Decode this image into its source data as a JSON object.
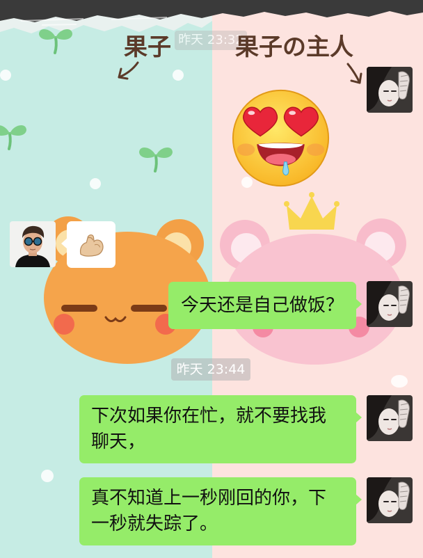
{
  "colors": {
    "left_background": "#c6ece4",
    "right_background": "#fde3df",
    "bubble_self": "#95ec69",
    "bubble_other": "#ffffff",
    "handwriting": "#5b3a29",
    "message_text": "#111111",
    "timestamp_text": "#ffffff"
  },
  "wallpaper": {
    "left_label": "果子",
    "right_label": "果子の主人",
    "left_character_icon": "orange-bear-icon",
    "right_character_icon": "pink-bear-crown-icon",
    "decoration_icon": "sprout-icon"
  },
  "chat": {
    "timestamps": [
      "昨天 23:32",
      "昨天 23:44"
    ],
    "avatars": {
      "self_icon": "girl-photo-avatar-icon",
      "other_icon": "man-sunglasses-avatar-icon"
    },
    "messages": [
      {
        "outgoing": true,
        "icon": "heart-eyes-drooling-face-icon"
      },
      {
        "outgoing": false,
        "icon": "flexed-biceps-icon"
      },
      {
        "outgoing": true,
        "lines": [
          "今天还是自己做饭？"
        ]
      },
      {
        "outgoing": true,
        "lines": [
          "下次如果你在忙，就不要找我",
          "聊天，"
        ]
      },
      {
        "outgoing": true,
        "lines": [
          "真不知道上一秒刚回的你，下",
          "一秒就失踪了。"
        ]
      }
    ]
  }
}
